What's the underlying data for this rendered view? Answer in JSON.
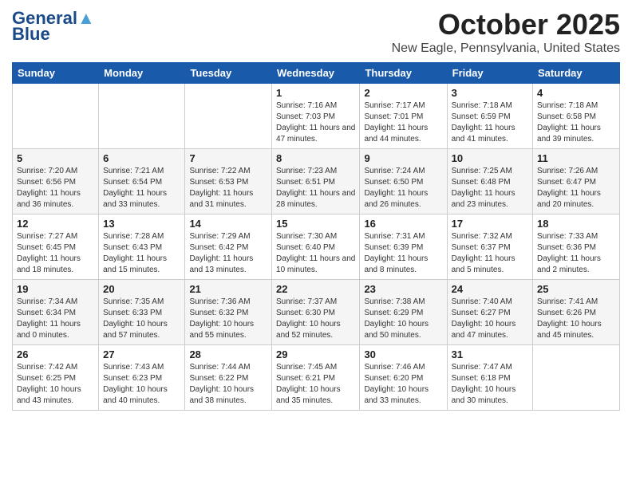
{
  "logo": {
    "line1": "General",
    "line2": "Blue"
  },
  "header": {
    "month": "October 2025",
    "location": "New Eagle, Pennsylvania, United States"
  },
  "days": [
    "Sunday",
    "Monday",
    "Tuesday",
    "Wednesday",
    "Thursday",
    "Friday",
    "Saturday"
  ],
  "weeks": [
    [
      {
        "day": "",
        "info": ""
      },
      {
        "day": "",
        "info": ""
      },
      {
        "day": "",
        "info": ""
      },
      {
        "day": "1",
        "info": "Sunrise: 7:16 AM\nSunset: 7:03 PM\nDaylight: 11 hours and 47 minutes."
      },
      {
        "day": "2",
        "info": "Sunrise: 7:17 AM\nSunset: 7:01 PM\nDaylight: 11 hours and 44 minutes."
      },
      {
        "day": "3",
        "info": "Sunrise: 7:18 AM\nSunset: 6:59 PM\nDaylight: 11 hours and 41 minutes."
      },
      {
        "day": "4",
        "info": "Sunrise: 7:18 AM\nSunset: 6:58 PM\nDaylight: 11 hours and 39 minutes."
      }
    ],
    [
      {
        "day": "5",
        "info": "Sunrise: 7:20 AM\nSunset: 6:56 PM\nDaylight: 11 hours and 36 minutes."
      },
      {
        "day": "6",
        "info": "Sunrise: 7:21 AM\nSunset: 6:54 PM\nDaylight: 11 hours and 33 minutes."
      },
      {
        "day": "7",
        "info": "Sunrise: 7:22 AM\nSunset: 6:53 PM\nDaylight: 11 hours and 31 minutes."
      },
      {
        "day": "8",
        "info": "Sunrise: 7:23 AM\nSunset: 6:51 PM\nDaylight: 11 hours and 28 minutes."
      },
      {
        "day": "9",
        "info": "Sunrise: 7:24 AM\nSunset: 6:50 PM\nDaylight: 11 hours and 26 minutes."
      },
      {
        "day": "10",
        "info": "Sunrise: 7:25 AM\nSunset: 6:48 PM\nDaylight: 11 hours and 23 minutes."
      },
      {
        "day": "11",
        "info": "Sunrise: 7:26 AM\nSunset: 6:47 PM\nDaylight: 11 hours and 20 minutes."
      }
    ],
    [
      {
        "day": "12",
        "info": "Sunrise: 7:27 AM\nSunset: 6:45 PM\nDaylight: 11 hours and 18 minutes."
      },
      {
        "day": "13",
        "info": "Sunrise: 7:28 AM\nSunset: 6:43 PM\nDaylight: 11 hours and 15 minutes."
      },
      {
        "day": "14",
        "info": "Sunrise: 7:29 AM\nSunset: 6:42 PM\nDaylight: 11 hours and 13 minutes."
      },
      {
        "day": "15",
        "info": "Sunrise: 7:30 AM\nSunset: 6:40 PM\nDaylight: 11 hours and 10 minutes."
      },
      {
        "day": "16",
        "info": "Sunrise: 7:31 AM\nSunset: 6:39 PM\nDaylight: 11 hours and 8 minutes."
      },
      {
        "day": "17",
        "info": "Sunrise: 7:32 AM\nSunset: 6:37 PM\nDaylight: 11 hours and 5 minutes."
      },
      {
        "day": "18",
        "info": "Sunrise: 7:33 AM\nSunset: 6:36 PM\nDaylight: 11 hours and 2 minutes."
      }
    ],
    [
      {
        "day": "19",
        "info": "Sunrise: 7:34 AM\nSunset: 6:34 PM\nDaylight: 11 hours and 0 minutes."
      },
      {
        "day": "20",
        "info": "Sunrise: 7:35 AM\nSunset: 6:33 PM\nDaylight: 10 hours and 57 minutes."
      },
      {
        "day": "21",
        "info": "Sunrise: 7:36 AM\nSunset: 6:32 PM\nDaylight: 10 hours and 55 minutes."
      },
      {
        "day": "22",
        "info": "Sunrise: 7:37 AM\nSunset: 6:30 PM\nDaylight: 10 hours and 52 minutes."
      },
      {
        "day": "23",
        "info": "Sunrise: 7:38 AM\nSunset: 6:29 PM\nDaylight: 10 hours and 50 minutes."
      },
      {
        "day": "24",
        "info": "Sunrise: 7:40 AM\nSunset: 6:27 PM\nDaylight: 10 hours and 47 minutes."
      },
      {
        "day": "25",
        "info": "Sunrise: 7:41 AM\nSunset: 6:26 PM\nDaylight: 10 hours and 45 minutes."
      }
    ],
    [
      {
        "day": "26",
        "info": "Sunrise: 7:42 AM\nSunset: 6:25 PM\nDaylight: 10 hours and 43 minutes."
      },
      {
        "day": "27",
        "info": "Sunrise: 7:43 AM\nSunset: 6:23 PM\nDaylight: 10 hours and 40 minutes."
      },
      {
        "day": "28",
        "info": "Sunrise: 7:44 AM\nSunset: 6:22 PM\nDaylight: 10 hours and 38 minutes."
      },
      {
        "day": "29",
        "info": "Sunrise: 7:45 AM\nSunset: 6:21 PM\nDaylight: 10 hours and 35 minutes."
      },
      {
        "day": "30",
        "info": "Sunrise: 7:46 AM\nSunset: 6:20 PM\nDaylight: 10 hours and 33 minutes."
      },
      {
        "day": "31",
        "info": "Sunrise: 7:47 AM\nSunset: 6:18 PM\nDaylight: 10 hours and 30 minutes."
      },
      {
        "day": "",
        "info": ""
      }
    ]
  ]
}
